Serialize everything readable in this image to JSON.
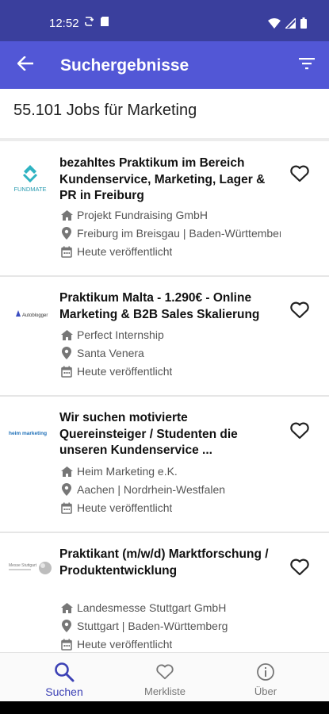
{
  "status_bar": {
    "time": "12:52",
    "left_icons": [
      "sync-icon",
      "sd-card-icon"
    ],
    "right_icons": [
      "wifi-icon",
      "signal-icon",
      "battery-icon"
    ]
  },
  "app_bar": {
    "title": "Suchergebnisse",
    "back_icon": "arrow-left-icon",
    "filter_icon": "filter-icon",
    "background": "#5257d6",
    "status_background": "#3a3f9d"
  },
  "results": {
    "count_text": "55.101 Jobs für Marketing"
  },
  "jobs": [
    {
      "logo_text": "FUNDMATE",
      "title": "bezahltes Praktikum im Bereich Kundenservice, Marketing, Lager & PR in Freiburg",
      "company": "Projekt Fundraising GmbH",
      "location": "Freiburg im Breisgau | Baden-Württemberg",
      "published": "Heute veröffentlicht"
    },
    {
      "logo_text": "Autoblogger",
      "title": "Praktikum Malta - 1.290€ - Online Marketing & B2B Sales Skalierung",
      "company": "Perfect Internship",
      "location": "Santa Venera",
      "published": "Heute veröffentlicht"
    },
    {
      "logo_text": "heim marketing",
      "title": "Wir suchen motivierte Quereinsteiger / Studenten die unseren Kundenservice ...",
      "company": "Heim Marketing e.K.",
      "location": "Aachen | Nordrhein-Westfalen",
      "published": "Heute veröffentlicht"
    },
    {
      "logo_text": "Messe Stuttgart",
      "title": "Praktikant (m/w/d) Marktforschung / Produktentwicklung",
      "company": "Landesmesse Stuttgart GmbH",
      "location": "Stuttgart | Baden-Württemberg",
      "published": "Heute veröffentlicht"
    }
  ],
  "bottom_nav": [
    {
      "label": "Suchen",
      "icon": "search-icon",
      "active": true
    },
    {
      "label": "Merkliste",
      "icon": "heart-outline-icon",
      "active": false
    },
    {
      "label": "Über",
      "icon": "info-icon",
      "active": false
    }
  ],
  "colors": {
    "accent": "#3c41b5",
    "logo_teal": "#2fb3c2"
  }
}
